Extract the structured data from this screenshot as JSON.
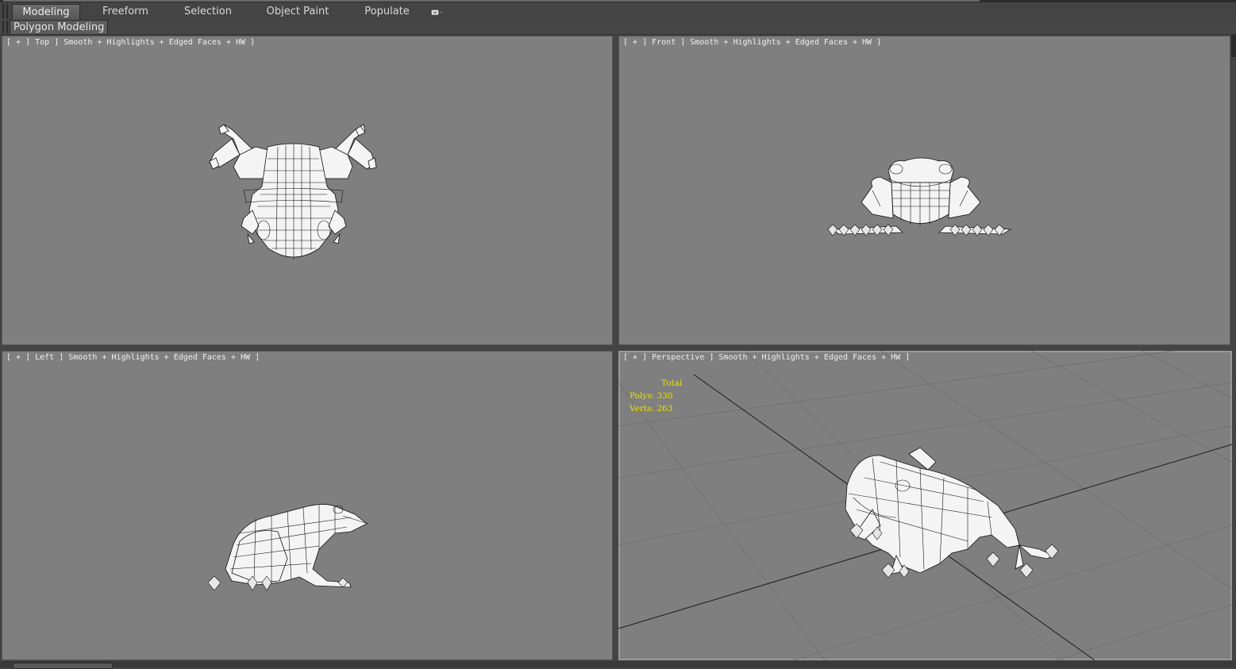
{
  "ribbon": {
    "tabs": [
      {
        "label": "Modeling",
        "active": true
      },
      {
        "label": "Freeform"
      },
      {
        "label": "Selection"
      },
      {
        "label": "Object Paint"
      },
      {
        "label": "Populate"
      }
    ],
    "subtab": "Polygon Modeling"
  },
  "viewports": [
    {
      "label": "[ + ] Top ] Smooth + Highlights + Edged Faces + HW ]"
    },
    {
      "label": "[ + ] Front ] Smooth + Highlights + Edged Faces + HW ]"
    },
    {
      "label": "[ + ] Left ] Smooth + Highlights + Edged Faces + HW ]"
    },
    {
      "label": "[ + ] Perspective ] Smooth + Highlights + Edged Faces + HW ]"
    }
  ],
  "stats": {
    "title": "Total",
    "polys": "Polys: 330",
    "verts": "Verts: 263"
  },
  "colors": {
    "viewport_bg": "#7f7f7f",
    "stats_text": "#e8e000",
    "ui_bg": "#444444"
  },
  "icons": [
    "dropdown-icon",
    "frog-model"
  ]
}
